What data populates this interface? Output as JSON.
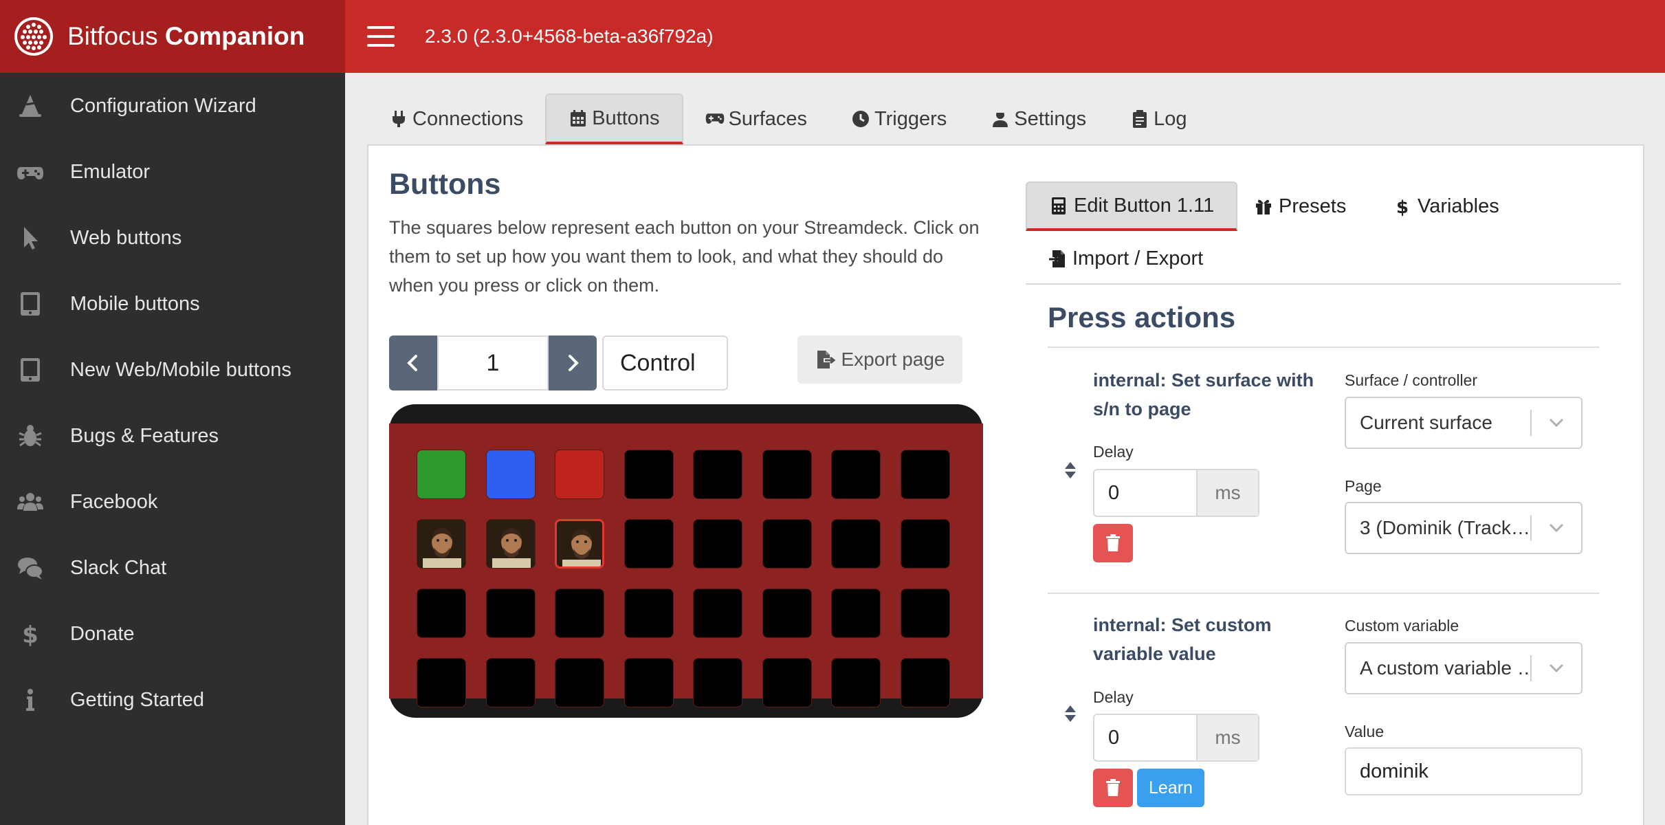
{
  "app": {
    "brand_prefix": "Bitfocus",
    "brand_name": "Companion",
    "version": "2.3.0 (2.3.0+4568-beta-a36f792a)"
  },
  "sidebar": {
    "items": [
      {
        "label": "Configuration Wizard",
        "icon": "wizard-hat-icon"
      },
      {
        "label": "Emulator",
        "icon": "gamepad-icon"
      },
      {
        "label": "Web buttons",
        "icon": "mouse-pointer-icon"
      },
      {
        "label": "Mobile buttons",
        "icon": "tablet-icon"
      },
      {
        "label": "New Web/Mobile buttons",
        "icon": "tablet-icon"
      },
      {
        "label": "Bugs & Features",
        "icon": "bug-icon"
      },
      {
        "label": "Facebook",
        "icon": "users-icon"
      },
      {
        "label": "Slack Chat",
        "icon": "comments-icon"
      },
      {
        "label": "Donate",
        "icon": "dollar-icon"
      },
      {
        "label": "Getting Started",
        "icon": "info-icon"
      }
    ]
  },
  "tabs": [
    {
      "label": "Connections",
      "icon": "plug-icon"
    },
    {
      "label": "Buttons",
      "icon": "calendar-icon",
      "active": true
    },
    {
      "label": "Surfaces",
      "icon": "gamepad-icon"
    },
    {
      "label": "Triggers",
      "icon": "clock-icon"
    },
    {
      "label": "Settings",
      "icon": "user-cog-icon"
    },
    {
      "label": "Log",
      "icon": "clipboard-icon"
    }
  ],
  "buttons_page": {
    "title": "Buttons",
    "description": "The squares below represent each button on your Streamdeck. Click on them to set up how you want them to look, and what they should do when you press or click on them.",
    "page_number": "1",
    "page_name": "Control",
    "export_label": "Export page"
  },
  "grid": {
    "rows": 4,
    "cols": 8,
    "colors": {
      "green": "#2e9a2e",
      "blue": "#2f5ef0",
      "red": "#c0241f",
      "empty": "#000000",
      "frame": "#8c2320"
    },
    "keys": [
      [
        "green",
        "blue",
        "red",
        "empty",
        "empty",
        "empty",
        "empty",
        "empty"
      ],
      [
        "photo",
        "photo",
        "photo-selected",
        "empty",
        "empty",
        "empty",
        "empty",
        "empty"
      ],
      [
        "empty",
        "empty",
        "empty",
        "empty",
        "empty",
        "empty",
        "empty",
        "empty"
      ],
      [
        "empty",
        "empty",
        "empty",
        "empty",
        "empty",
        "empty",
        "empty",
        "empty"
      ]
    ]
  },
  "right_tabs": [
    {
      "label": "Edit Button 1.11",
      "icon": "calculator-icon",
      "active": true
    },
    {
      "label": "Presets",
      "icon": "gift-icon"
    },
    {
      "label": "Variables",
      "icon": "dollar-icon"
    },
    {
      "label": "Import / Export",
      "icon": "file-import-icon"
    }
  ],
  "press_actions": {
    "title": "Press actions",
    "actions": [
      {
        "title": "internal: Set surface with s/n to page",
        "delay_label": "Delay",
        "delay_value": "0",
        "delay_unit": "ms",
        "options": [
          {
            "label": "Surface / controller",
            "type": "select",
            "value": "Current surface"
          },
          {
            "label": "Page",
            "type": "select",
            "value": "3 (Dominik (Track…"
          }
        ]
      },
      {
        "title": "internal: Set custom variable value",
        "delay_label": "Delay",
        "delay_value": "0",
        "delay_unit": "ms",
        "learn_label": "Learn",
        "options": [
          {
            "label": "Custom variable",
            "type": "select",
            "value": "A custom variable …"
          },
          {
            "label": "Value",
            "type": "text",
            "value": "dominik"
          }
        ]
      }
    ]
  }
}
